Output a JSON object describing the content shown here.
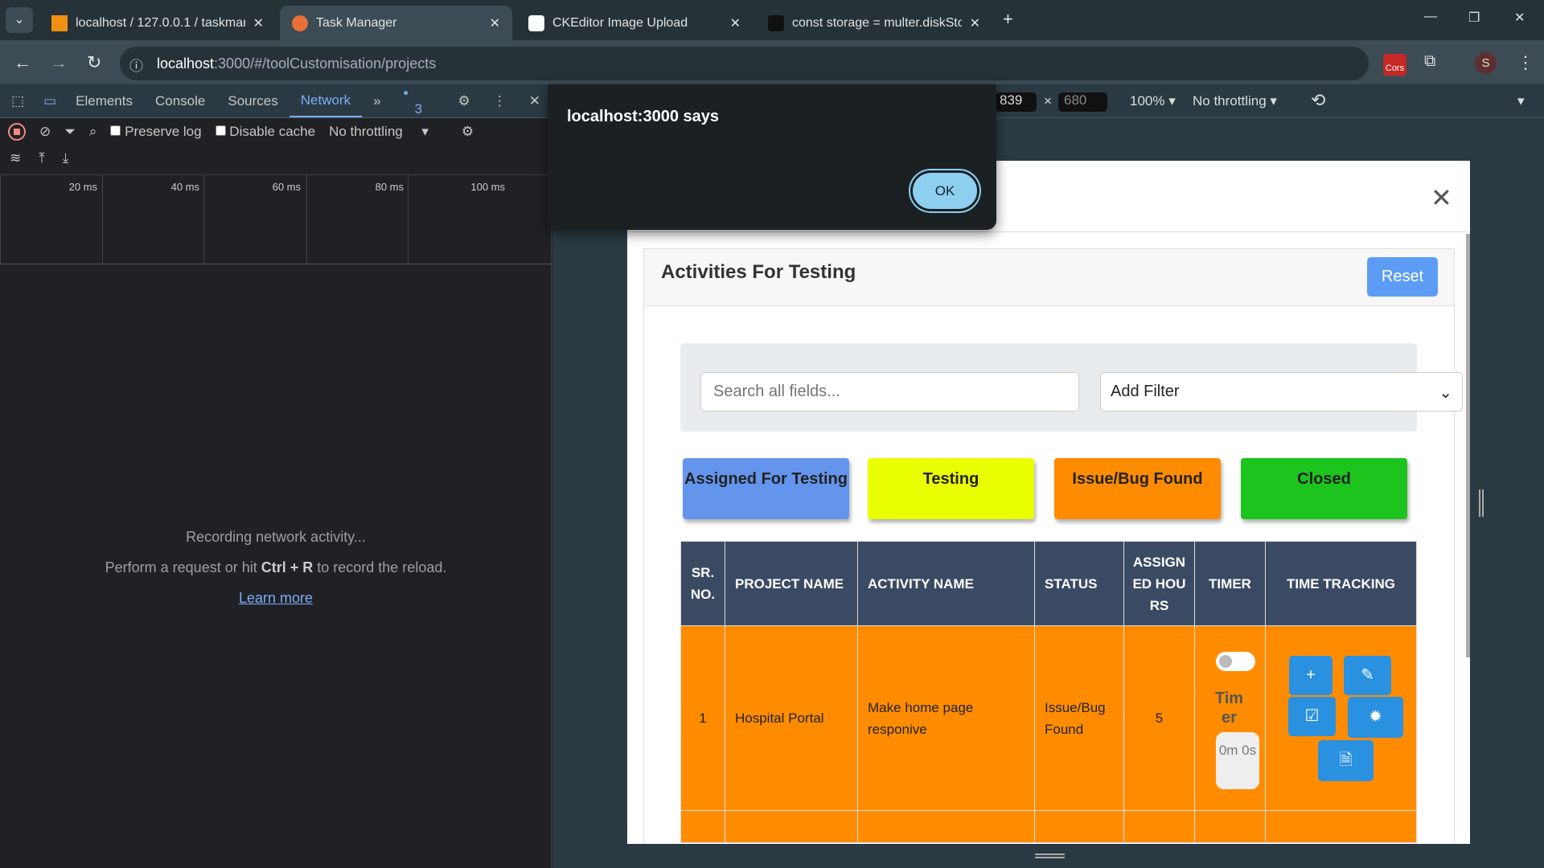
{
  "browser": {
    "tabs": [
      {
        "title": "localhost / 127.0.0.1 / taskmana"
      },
      {
        "title": "Task Manager",
        "active": true
      },
      {
        "title": "CKEditor Image Upload"
      },
      {
        "title": "const storage = multer.diskStor"
      }
    ],
    "url_host": "localhost",
    "url_path": ":3000/#/toolCustomisation/projects",
    "profile_initial": "S",
    "extension_label": "Cors"
  },
  "devtools": {
    "tabs": [
      "Elements",
      "Console",
      "Sources",
      "Network"
    ],
    "active_tab": "Network",
    "issues_count": "3",
    "preserve_log": "Preserve log",
    "disable_cache": "Disable cache",
    "throttling": "No throttling",
    "ticks": [
      "20 ms",
      "40 ms",
      "60 ms",
      "80 ms",
      "100 ms"
    ],
    "empty_line1": "Recording network activity...",
    "empty_line2_pre": "Perform a request or hit ",
    "empty_line2_key": "Ctrl + R",
    "empty_line2_post": " to record the reload.",
    "learn_more": "Learn more"
  },
  "device_toolbar": {
    "width": "839",
    "height": "680",
    "zoom": "100%",
    "throttling": "No throttling"
  },
  "alert": {
    "message": "localhost:3000 says",
    "ok": "OK"
  },
  "modal": {
    "title": "Activities For Testing",
    "reset": "Reset",
    "search_placeholder": "Search all fields...",
    "filter_selected": "Add Filter",
    "status_buttons": [
      {
        "label": "Assigned For Testing",
        "color": "#6495ed"
      },
      {
        "label": "Testing",
        "color": "#eaff00"
      },
      {
        "label": "Issue/Bug Found",
        "color": "#ff8c00"
      },
      {
        "label": "Closed",
        "color": "#1ec41e"
      }
    ],
    "columns": [
      "SR. NO.",
      "PROJECT NAME",
      "ACTIVITY NAME",
      "STATUS",
      "ASSIGNED HOURS",
      "TIMER",
      "TIME TRACKING"
    ],
    "rows": [
      {
        "sr": "1",
        "project": "Hospital Portal",
        "activity": "Make home page responive",
        "status": "Issue/Bug Found",
        "hours": "5",
        "timer_label": "Timer",
        "timer_value": "0m 0s",
        "timer_on": false
      }
    ]
  }
}
